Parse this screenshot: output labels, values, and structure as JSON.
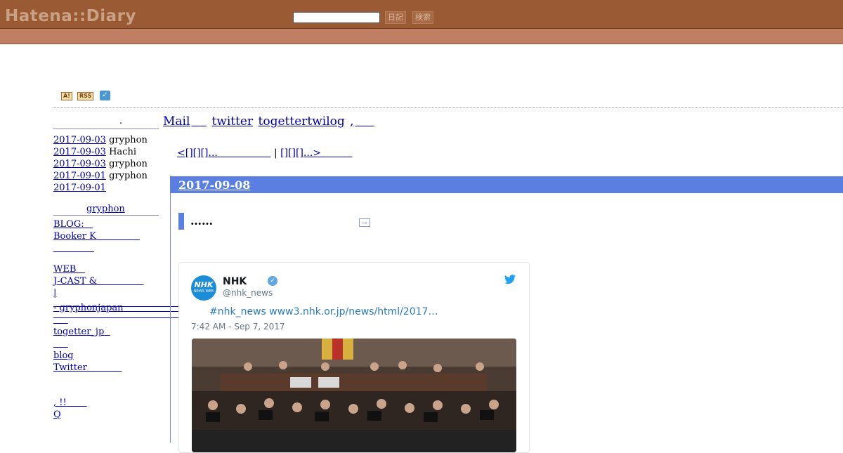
{
  "header": {
    "logo": "Hatena::Diary",
    "search_placeholder": "",
    "diary_button": "日記",
    "search_button": "検索"
  },
  "badges": {
    "a": "A!",
    "rss": "RSS",
    "twitter_icon": "twitter-bird-icon"
  },
  "sidebar": {
    "title": ".",
    "recent_comments": [
      {
        "date": "2017-09-03",
        "author": "gryphon"
      },
      {
        "date": "2017-09-03",
        "author": "Hachi"
      },
      {
        "date": "2017-09-03",
        "author": "gryphon"
      },
      {
        "date": "2017-09-01",
        "author": "gryphon"
      },
      {
        "date": "2017-09-01",
        "author": ""
      }
    ],
    "profile_name": "gryphon",
    "links": [
      "BLOG:",
      "Booker K",
      "",
      "WEB",
      "J-CAST &",
      "|",
      " - gryphonjapan",
      "",
      "togetter_jp",
      "",
      "blog",
      "Twitter",
      ", !!",
      "Q"
    ]
  },
  "nav": {
    "mail": "Mail",
    "twitter": "twitter",
    "togetter": "togettertwilog",
    "extra": ","
  },
  "pager": {
    "prev": "<[][][]...",
    "separator": "|",
    "next": "[][][]...>"
  },
  "entry": {
    "date": "2017-09-08",
    "title": "……",
    "tweet": {
      "avatar_top": "NHK",
      "avatar_bottom": "NEWS WEB",
      "name": "NHK",
      "handle": "@nhk_news",
      "link_text": "#nhk_news www3.nhk.or.jp/news/html/2017…",
      "time": "7:42 AM - Sep 7, 2017"
    }
  }
}
